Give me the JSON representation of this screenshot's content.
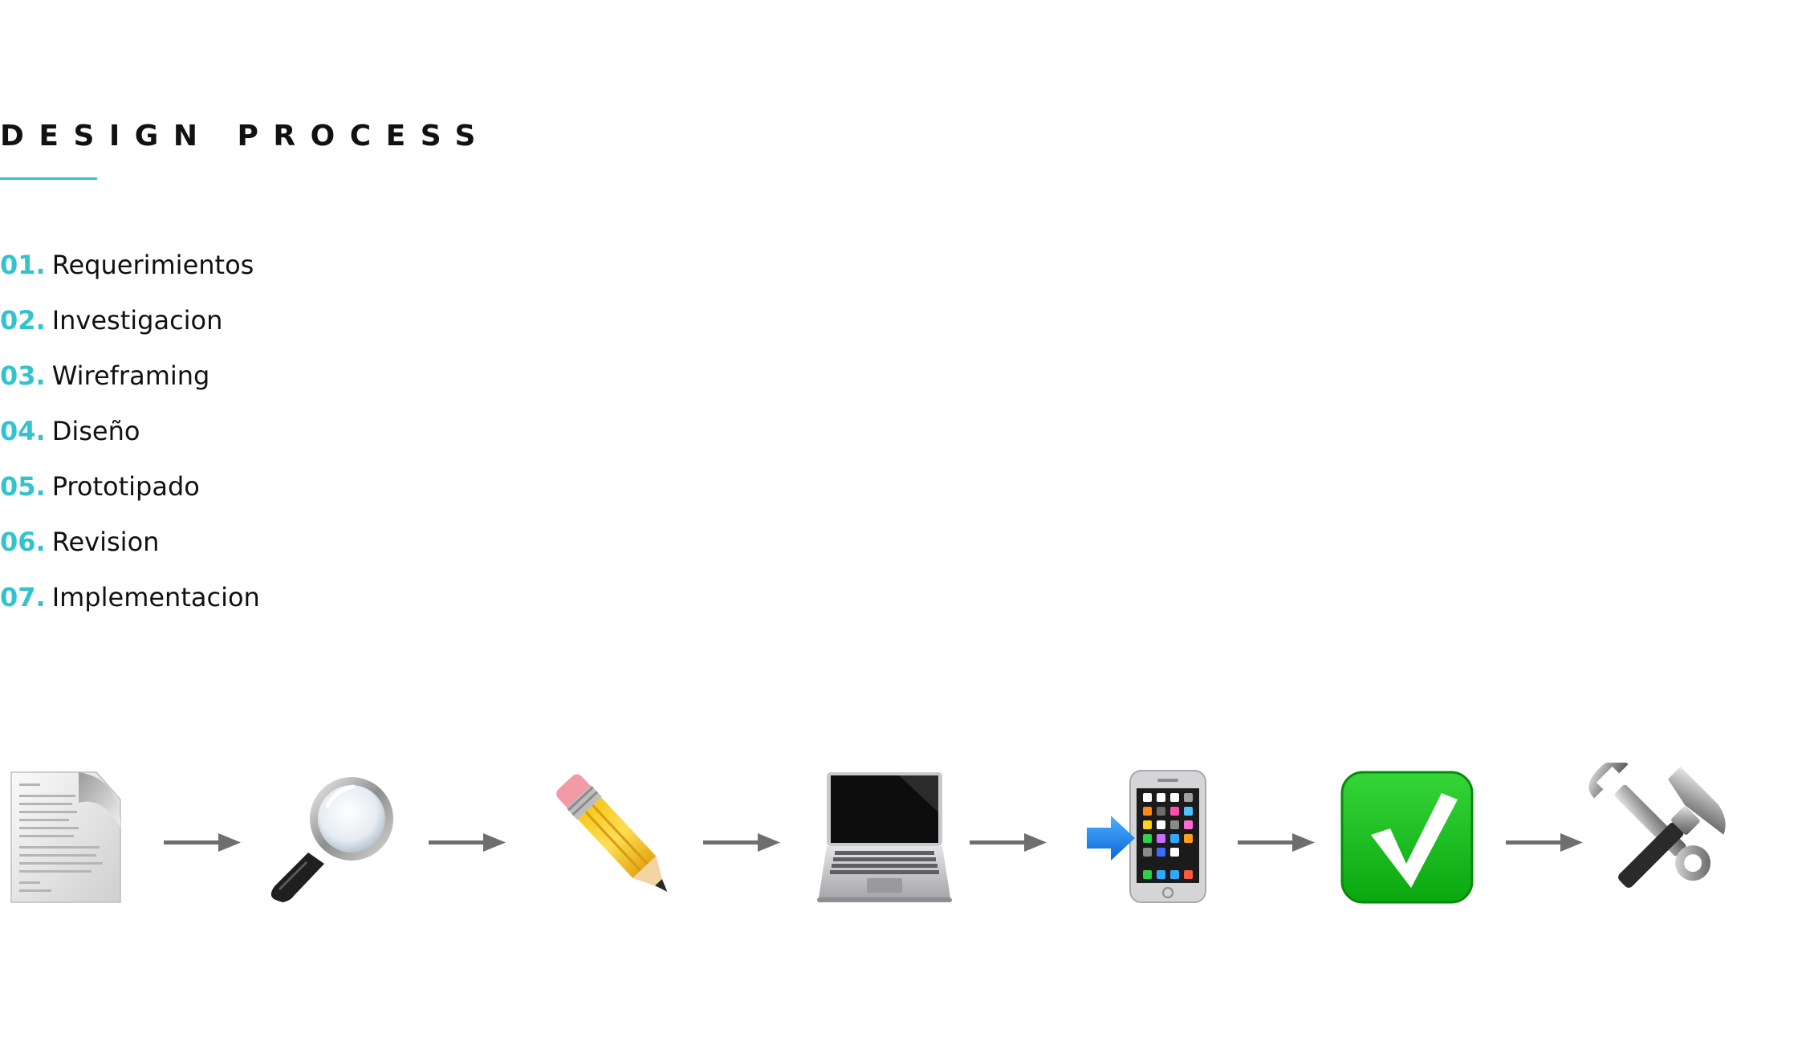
{
  "header": {
    "title": "DESIGN PROCESS",
    "underline_color": "#33c3cf"
  },
  "steps": [
    {
      "number": "01.",
      "label": "Requerimientos"
    },
    {
      "number": "02.",
      "label": "Investigacion"
    },
    {
      "number": "03.",
      "label": "Wireframing"
    },
    {
      "number": "04.",
      "label": "Diseño"
    },
    {
      "number": "05.",
      "label": "Prototipado"
    },
    {
      "number": "06.",
      "label": "Revision"
    },
    {
      "number": "07.",
      "label": "Implementacion"
    }
  ],
  "flow": {
    "icons": [
      "document-icon",
      "magnifying-glass-icon",
      "pencil-icon",
      "laptop-icon",
      "phone-with-arrow-icon",
      "check-mark-icon",
      "hammer-and-wrench-icon"
    ],
    "arrow_color": "#6e6e6e",
    "accent_color": "#33c3cf"
  }
}
